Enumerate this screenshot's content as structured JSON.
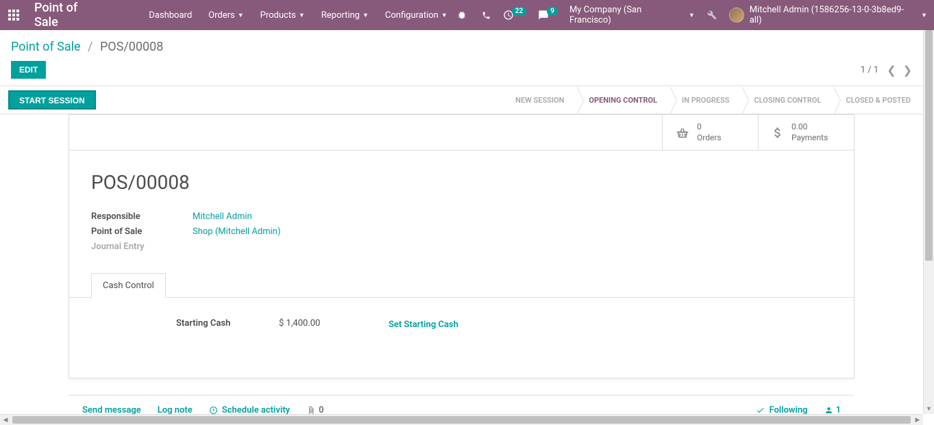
{
  "brand": "Point of Sale",
  "nav": {
    "dashboard": "Dashboard",
    "orders": "Orders",
    "products": "Products",
    "reporting": "Reporting",
    "configuration": "Configuration"
  },
  "badges": {
    "clock": "22",
    "chat": "9"
  },
  "company": "My Company (San Francisco)",
  "user": "Mitchell Admin (1586256-13-0-3b8ed9-all)",
  "breadcrumb": {
    "root": "Point of Sale",
    "current": "POS/00008"
  },
  "buttons": {
    "edit": "EDIT",
    "start_session": "START SESSION"
  },
  "pager": {
    "text": "1 / 1"
  },
  "stages": {
    "new_session": "NEW SESSION",
    "opening_control": "OPENING CONTROL",
    "in_progress": "IN PROGRESS",
    "closing_control": "CLOSING CONTROL",
    "closed_posted": "CLOSED & POSTED"
  },
  "stats": {
    "orders_count": "0",
    "orders_label": "Orders",
    "payments_amount": "0.00",
    "payments_label": "Payments"
  },
  "record": {
    "title": "POS/00008",
    "responsible_label": "Responsible",
    "responsible_value": "Mitchell Admin",
    "pos_label": "Point of Sale",
    "pos_value": "Shop (Mitchell Admin)",
    "journal_label": "Journal Entry"
  },
  "tabs": {
    "cash_control": "Cash Control"
  },
  "cash": {
    "starting_label": "Starting Cash",
    "starting_value": "$ 1,400.00",
    "set_link": "Set Starting Cash"
  },
  "chatter": {
    "send": "Send message",
    "log": "Log note",
    "schedule": "Schedule activity",
    "attach_count": "0",
    "following": "Following",
    "followers": "1"
  }
}
